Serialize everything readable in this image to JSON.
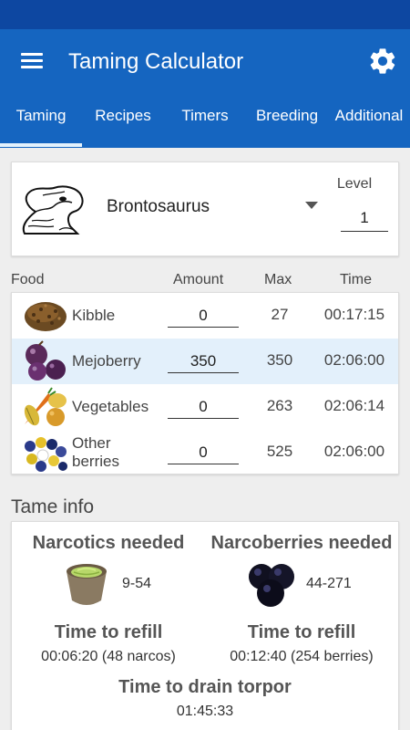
{
  "app": {
    "title": "Taming Calculator"
  },
  "tabs": [
    {
      "label": "Taming",
      "active": true
    },
    {
      "label": "Recipes"
    },
    {
      "label": "Timers"
    },
    {
      "label": "Breeding"
    },
    {
      "label": "Additional"
    }
  ],
  "creature": {
    "name": "Brontosaurus",
    "level_label": "Level",
    "level_value": "1"
  },
  "food_table": {
    "headers": {
      "food": "Food",
      "amount": "Amount",
      "max": "Max",
      "time": "Time"
    },
    "rows": [
      {
        "name": "Kibble",
        "amount": "0",
        "max": "27",
        "time": "00:17:15",
        "icon": "kibble-icon"
      },
      {
        "name": "Mejoberry",
        "amount": "350",
        "max": "350",
        "time": "02:06:00",
        "icon": "mejoberry-icon",
        "selected": true
      },
      {
        "name": "Vegetables",
        "amount": "0",
        "max": "263",
        "time": "02:06:14",
        "icon": "vegetables-icon"
      },
      {
        "name_line1": "Other",
        "name_line2": "berries",
        "amount": "0",
        "max": "525",
        "time": "02:06:00",
        "icon": "other-berries-icon"
      }
    ]
  },
  "tame_info": {
    "title": "Tame info",
    "narcotics": {
      "label": "Narcotics needed",
      "range": "9-54",
      "refill_label": "Time to refill",
      "refill_value": "00:06:20 (48 narcos)",
      "icon": "narcotic-icon"
    },
    "narcoberries": {
      "label": "Narcoberries needed",
      "range": "44-271",
      "refill_label": "Time to refill",
      "refill_value": "00:12:40 (254 berries)",
      "icon": "narcoberry-icon"
    },
    "torpor": {
      "label": "Time to drain torpor",
      "value": "01:45:33"
    }
  },
  "colors": {
    "primary": "#1565c0",
    "primary_dark": "#0d47a1",
    "selected_row": "#e3f0fb"
  }
}
